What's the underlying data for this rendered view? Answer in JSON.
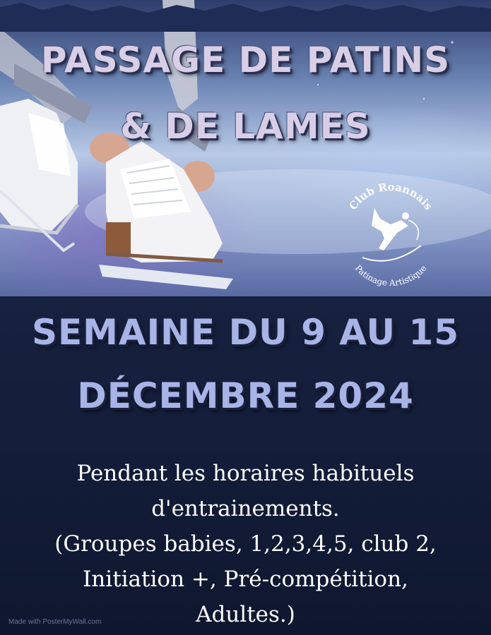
{
  "poster": {
    "title_line1": "PASSAGE DE PATINS",
    "title_line2": "& DE LAMES",
    "logo": {
      "top_text": "Club Roannais",
      "bottom_text": "Patinage Artistique",
      "icon": "skater-icon"
    },
    "date_line1": "SEMAINE DU 9 AU 15",
    "date_line2": "DÉCEMBRE 2024",
    "info_lines": [
      "Pendant les horaires habituels",
      "d'entrainements.",
      "(Groupes babies, 1,2,3,4,5, club 2,",
      "Initiation +, Pré-compétition,",
      "Adultes.)"
    ],
    "credit": "Made with PosterMyWall.com"
  },
  "colors": {
    "background": "#17213f",
    "title": "#d8cfe6",
    "date": "#a8b3e6",
    "info": "#ffffff"
  }
}
